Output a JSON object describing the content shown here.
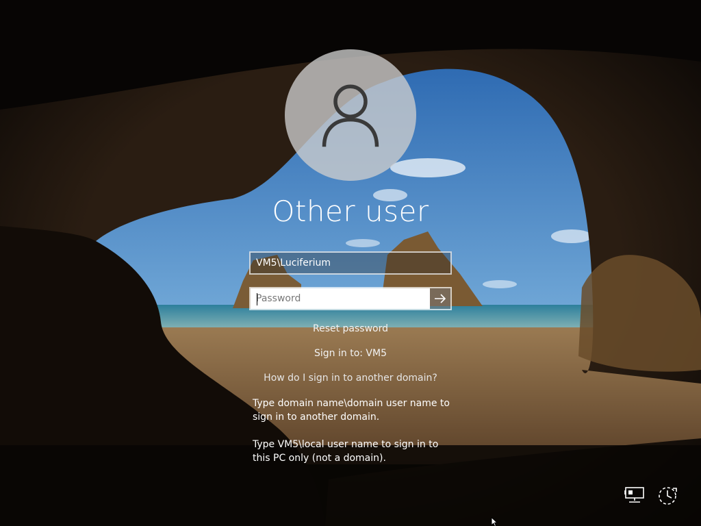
{
  "user": {
    "display_name": "Other user",
    "username_value": "VM5\\Luciferium"
  },
  "password": {
    "placeholder": "Password",
    "submit_icon": "arrow-right-icon"
  },
  "links": {
    "reset_password": "Reset password",
    "sign_in_to": "Sign in to: VM5",
    "domain_question": "How do I sign in to another domain?"
  },
  "help": {
    "domain_instructions": "Type domain name\\domain user name to sign in to another domain.",
    "local_instructions": "Type VM5\\local user name to sign in to this PC only (not a domain)."
  },
  "icons": {
    "avatar": "user-silhouette-icon",
    "network": "network-icon",
    "accessibility": "ease-of-access-icon"
  },
  "colors": {
    "sky": "#2f6db3",
    "sea": "#3c8fa8",
    "sand": "#8a6a45",
    "rock": "#3a2a1a"
  }
}
